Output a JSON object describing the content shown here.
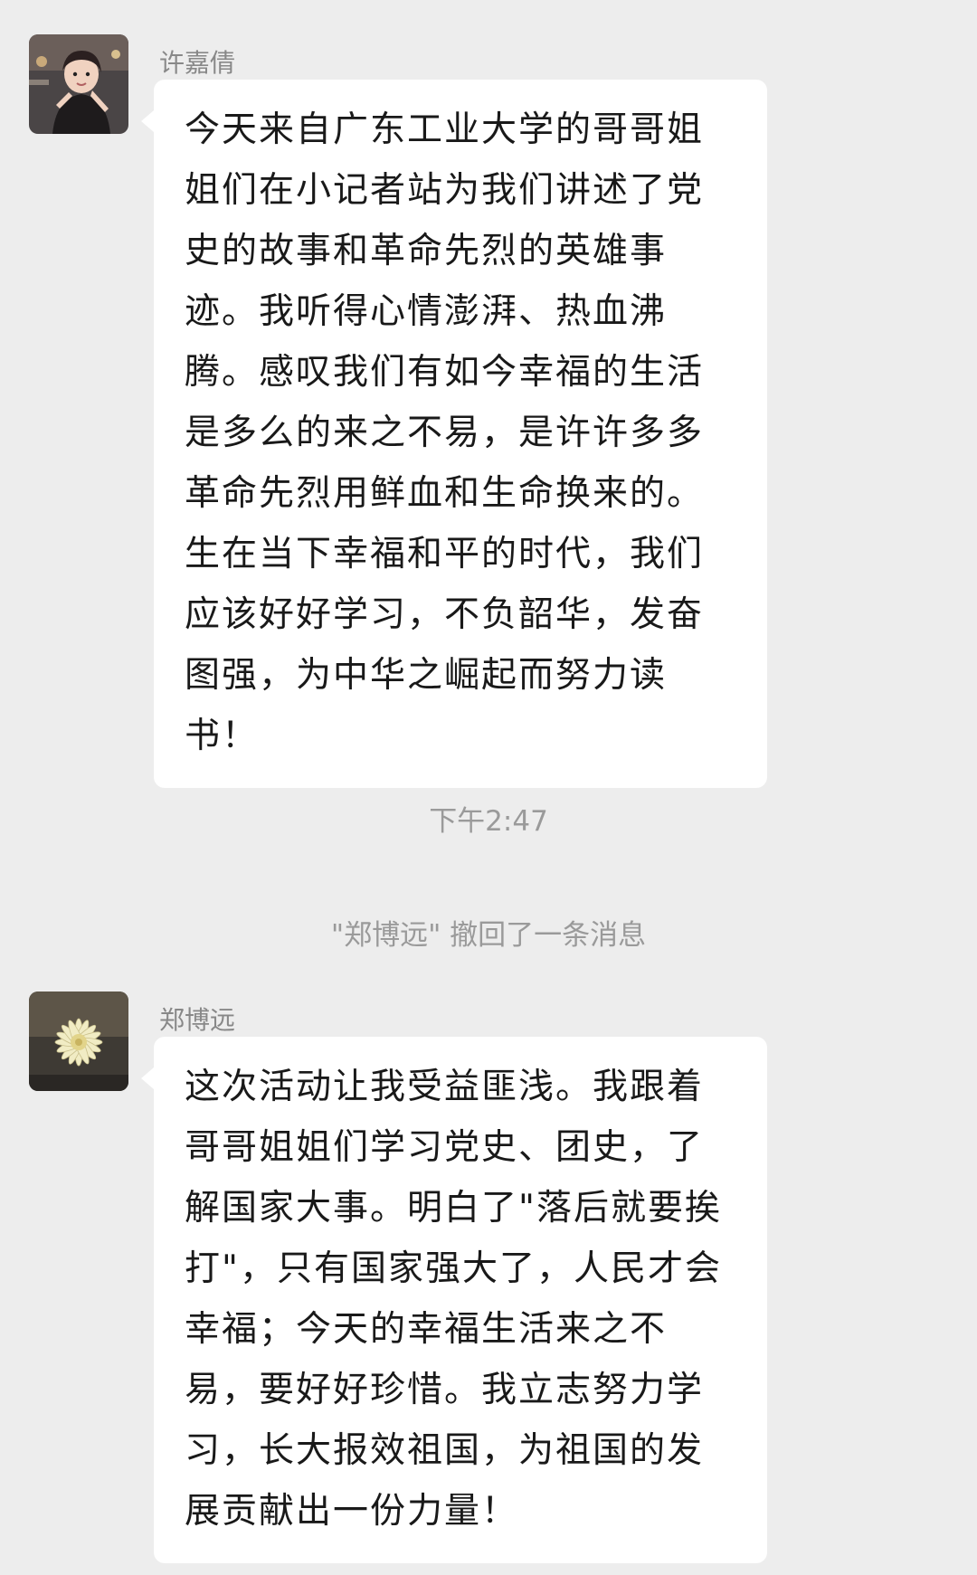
{
  "messages": [
    {
      "sender": "许嘉倩",
      "avatar_icon": "child-photo-avatar",
      "text": "今天来自广东工业大学的哥哥姐姐们在小记者站为我们讲述了党史的故事和革命先烈的英雄事迹。我听得心情澎湃、热血沸腾。感叹我们有如今幸福的生活是多么的来之不易，是许许多多革命先烈用鲜血和生命换来的。生在当下幸福和平的时代，我们应该好好学习，不负韶华，发奋图强，为中华之崛起而努力读书！"
    },
    {
      "sender": "郑博远",
      "avatar_icon": "flower-photo-avatar",
      "text": "这次活动让我受益匪浅。我跟着哥哥姐姐们学习党史、团史，了解国家大事。明白了\"落后就要挨打\"，只有国家强大了，人民才会幸福；今天的幸福生活来之不易，要好好珍惜。我立志努力学习，长大报效祖国，为祖国的发展贡献出一份力量！"
    }
  ],
  "timestamp": "下午2:47",
  "recall_notice": "\"郑博远\" 撤回了一条消息",
  "colors": {
    "background": "#ededed",
    "bubble": "#ffffff",
    "text": "#191919",
    "meta": "#9a9a9a"
  }
}
